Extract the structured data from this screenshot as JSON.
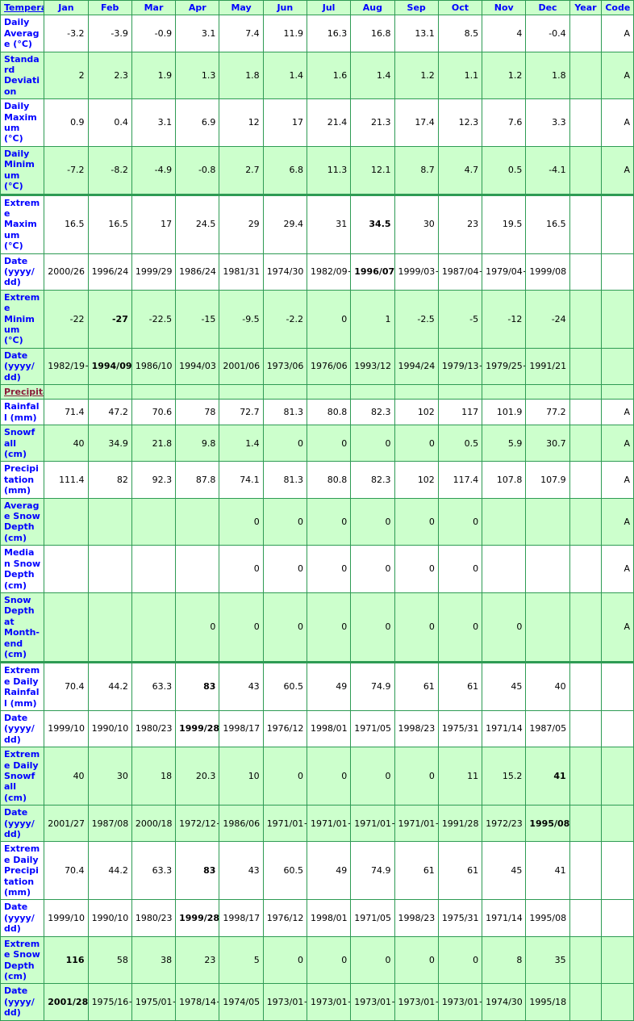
{
  "table": {
    "section_label_temperature": "Temperature:",
    "section_label_precipitation": "Precipitation:",
    "columns": [
      "Jan",
      "Feb",
      "Mar",
      "Apr",
      "May",
      "Jun",
      "Jul",
      "Aug",
      "Sep",
      "Oct",
      "Nov",
      "Dec"
    ],
    "year_header": "Year",
    "code_header": "Code",
    "colors": {
      "grid": "#2e9b54",
      "row_green": "#ccffcc",
      "row_white": "#ffffff",
      "label_blue": "#0000ff",
      "section_maroon": "#8b1a3a"
    },
    "rows": [
      {
        "label": "Daily Average (°C)",
        "shade": "white",
        "values": [
          "-3.2",
          "-3.9",
          "-0.9",
          "3.1",
          "7.4",
          "11.9",
          "16.3",
          "16.8",
          "13.1",
          "8.5",
          "4",
          "-0.4"
        ],
        "bold": [],
        "year": "",
        "code": "A"
      },
      {
        "label": "Standard Deviation",
        "shade": "green",
        "values": [
          "2",
          "2.3",
          "1.9",
          "1.3",
          "1.8",
          "1.4",
          "1.6",
          "1.4",
          "1.2",
          "1.1",
          "1.2",
          "1.8"
        ],
        "bold": [],
        "year": "",
        "code": "A"
      },
      {
        "label": "Daily Maximum (°C)",
        "shade": "white",
        "values": [
          "0.9",
          "0.4",
          "3.1",
          "6.9",
          "12",
          "17",
          "21.4",
          "21.3",
          "17.4",
          "12.3",
          "7.6",
          "3.3"
        ],
        "bold": [],
        "year": "",
        "code": "A"
      },
      {
        "label": "Daily Minimum (°C)",
        "shade": "green",
        "values": [
          "-7.2",
          "-8.2",
          "-4.9",
          "-0.8",
          "2.7",
          "6.8",
          "11.3",
          "12.1",
          "8.7",
          "4.7",
          "0.5",
          "-4.1"
        ],
        "bold": [],
        "year": "",
        "code": "A"
      },
      {
        "label": "Extreme Maximum (°C)",
        "shade": "white",
        "group_top": true,
        "values": [
          "16.5",
          "16.5",
          "17",
          "24.5",
          "29",
          "29.4",
          "31",
          "34.5",
          "30",
          "23",
          "19.5",
          "16.5"
        ],
        "bold": [
          7
        ],
        "year": "",
        "code": ""
      },
      {
        "label": "Date (yyyy/dd)",
        "shade": "white",
        "values": [
          "2000/26",
          "1996/24",
          "1999/29",
          "1986/24",
          "1981/31",
          "1974/30",
          "1982/09+",
          "1996/07",
          "1999/03+",
          "1987/04+",
          "1979/04+",
          "1999/08"
        ],
        "bold": [
          7
        ],
        "year": "",
        "code": ""
      },
      {
        "label": "Extreme Minimum (°C)",
        "shade": "green",
        "values": [
          "-22",
          "-27",
          "-22.5",
          "-15",
          "-9.5",
          "-2.2",
          "0",
          "1",
          "-2.5",
          "-5",
          "-12",
          "-24"
        ],
        "bold": [
          1
        ],
        "year": "",
        "code": ""
      },
      {
        "label": "Date (yyyy/dd)",
        "shade": "green",
        "values": [
          "1982/19+",
          "1994/09",
          "1986/10",
          "1994/03",
          "2001/06",
          "1973/06",
          "1976/06",
          "1993/12",
          "1994/24",
          "1979/13+",
          "1979/25+",
          "1991/21"
        ],
        "bold": [
          1
        ],
        "year": "",
        "code": ""
      },
      {
        "label": "Rainfall (mm)",
        "shade": "white",
        "values": [
          "71.4",
          "47.2",
          "70.6",
          "78",
          "72.7",
          "81.3",
          "80.8",
          "82.3",
          "102",
          "117",
          "101.9",
          "77.2"
        ],
        "bold": [],
        "year": "",
        "code": "A"
      },
      {
        "label": "Snowfall (cm)",
        "shade": "green",
        "values": [
          "40",
          "34.9",
          "21.8",
          "9.8",
          "1.4",
          "0",
          "0",
          "0",
          "0",
          "0.5",
          "5.9",
          "30.7"
        ],
        "bold": [],
        "year": "",
        "code": "A"
      },
      {
        "label": "Precipitation (mm)",
        "shade": "white",
        "values": [
          "111.4",
          "82",
          "92.3",
          "87.8",
          "74.1",
          "81.3",
          "80.8",
          "82.3",
          "102",
          "117.4",
          "107.8",
          "107.9"
        ],
        "bold": [],
        "year": "",
        "code": "A"
      },
      {
        "label": "Average Snow Depth (cm)",
        "shade": "green",
        "values": [
          "",
          "",
          "",
          "",
          "0",
          "0",
          "0",
          "0",
          "0",
          "0",
          "",
          ""
        ],
        "bold": [],
        "year": "",
        "code": "A"
      },
      {
        "label": "Median Snow Depth (cm)",
        "shade": "white",
        "values": [
          "",
          "",
          "",
          "",
          "0",
          "0",
          "0",
          "0",
          "0",
          "0",
          "",
          ""
        ],
        "bold": [],
        "year": "",
        "code": "A"
      },
      {
        "label": "Snow Depth at Month-end (cm)",
        "shade": "green",
        "values": [
          "",
          "",
          "",
          "0",
          "0",
          "0",
          "0",
          "0",
          "0",
          "0",
          "0",
          ""
        ],
        "bold": [],
        "year": "",
        "code": "A"
      },
      {
        "label": "Extreme Daily Rainfall (mm)",
        "shade": "white",
        "group_top": true,
        "values": [
          "70.4",
          "44.2",
          "63.3",
          "83",
          "43",
          "60.5",
          "49",
          "74.9",
          "61",
          "61",
          "45",
          "40"
        ],
        "bold": [
          3
        ],
        "year": "",
        "code": ""
      },
      {
        "label": "Date (yyyy/dd)",
        "shade": "white",
        "values": [
          "1999/10",
          "1990/10",
          "1980/23",
          "1999/28",
          "1998/17",
          "1976/12",
          "1998/01",
          "1971/05",
          "1998/23",
          "1975/31",
          "1971/14",
          "1987/05"
        ],
        "bold": [
          3
        ],
        "year": "",
        "code": ""
      },
      {
        "label": "Extreme Daily Snowfall (cm)",
        "shade": "green",
        "values": [
          "40",
          "30",
          "18",
          "20.3",
          "10",
          "0",
          "0",
          "0",
          "0",
          "11",
          "15.2",
          "41"
        ],
        "bold": [
          11
        ],
        "year": "",
        "code": ""
      },
      {
        "label": "Date (yyyy/dd)",
        "shade": "green",
        "values": [
          "2001/27",
          "1987/08",
          "2000/18",
          "1972/12+",
          "1986/06",
          "1971/01+",
          "1971/01+",
          "1971/01+",
          "1971/01+",
          "1991/28",
          "1972/23",
          "1995/08"
        ],
        "bold": [
          11
        ],
        "year": "",
        "code": ""
      },
      {
        "label": "Extreme Daily Precipitation (mm)",
        "shade": "white",
        "values": [
          "70.4",
          "44.2",
          "63.3",
          "83",
          "43",
          "60.5",
          "49",
          "74.9",
          "61",
          "61",
          "45",
          "41"
        ],
        "bold": [
          3
        ],
        "year": "",
        "code": ""
      },
      {
        "label": "Date (yyyy/dd)",
        "shade": "white",
        "values": [
          "1999/10",
          "1990/10",
          "1980/23",
          "1999/28",
          "1998/17",
          "1976/12",
          "1998/01",
          "1971/05",
          "1998/23",
          "1975/31",
          "1971/14",
          "1995/08"
        ],
        "bold": [
          3
        ],
        "year": "",
        "code": ""
      },
      {
        "label": "Extreme Snow Depth (cm)",
        "shade": "green",
        "values": [
          "116",
          "58",
          "38",
          "23",
          "5",
          "0",
          "0",
          "0",
          "0",
          "0",
          "8",
          "35"
        ],
        "bold": [
          0
        ],
        "year": "",
        "code": ""
      },
      {
        "label": "Date (yyyy/dd)",
        "shade": "green",
        "values": [
          "2001/28",
          "1975/16+",
          "1975/01+",
          "1978/14+",
          "1974/05",
          "1973/01+",
          "1973/01+",
          "1973/01+",
          "1973/01+",
          "1973/01+",
          "1974/30",
          "1995/18"
        ],
        "bold": [
          0
        ],
        "year": "",
        "code": ""
      }
    ],
    "section_break_after_row_index": 7
  }
}
